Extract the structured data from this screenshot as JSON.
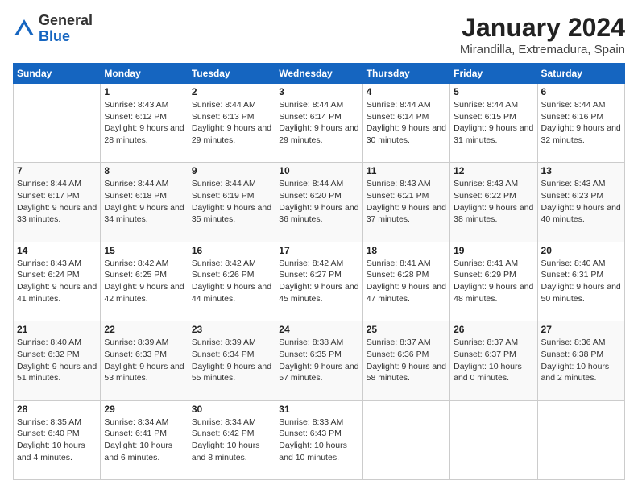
{
  "header": {
    "logo_general": "General",
    "logo_blue": "Blue",
    "month_title": "January 2024",
    "location": "Mirandilla, Extremadura, Spain"
  },
  "days_of_week": [
    "Sunday",
    "Monday",
    "Tuesday",
    "Wednesday",
    "Thursday",
    "Friday",
    "Saturday"
  ],
  "weeks": [
    [
      {
        "day": "",
        "sunrise": "",
        "sunset": "",
        "daylight": ""
      },
      {
        "day": "1",
        "sunrise": "Sunrise: 8:43 AM",
        "sunset": "Sunset: 6:12 PM",
        "daylight": "Daylight: 9 hours and 28 minutes."
      },
      {
        "day": "2",
        "sunrise": "Sunrise: 8:44 AM",
        "sunset": "Sunset: 6:13 PM",
        "daylight": "Daylight: 9 hours and 29 minutes."
      },
      {
        "day": "3",
        "sunrise": "Sunrise: 8:44 AM",
        "sunset": "Sunset: 6:14 PM",
        "daylight": "Daylight: 9 hours and 29 minutes."
      },
      {
        "day": "4",
        "sunrise": "Sunrise: 8:44 AM",
        "sunset": "Sunset: 6:14 PM",
        "daylight": "Daylight: 9 hours and 30 minutes."
      },
      {
        "day": "5",
        "sunrise": "Sunrise: 8:44 AM",
        "sunset": "Sunset: 6:15 PM",
        "daylight": "Daylight: 9 hours and 31 minutes."
      },
      {
        "day": "6",
        "sunrise": "Sunrise: 8:44 AM",
        "sunset": "Sunset: 6:16 PM",
        "daylight": "Daylight: 9 hours and 32 minutes."
      }
    ],
    [
      {
        "day": "7",
        "sunrise": "Sunrise: 8:44 AM",
        "sunset": "Sunset: 6:17 PM",
        "daylight": "Daylight: 9 hours and 33 minutes."
      },
      {
        "day": "8",
        "sunrise": "Sunrise: 8:44 AM",
        "sunset": "Sunset: 6:18 PM",
        "daylight": "Daylight: 9 hours and 34 minutes."
      },
      {
        "day": "9",
        "sunrise": "Sunrise: 8:44 AM",
        "sunset": "Sunset: 6:19 PM",
        "daylight": "Daylight: 9 hours and 35 minutes."
      },
      {
        "day": "10",
        "sunrise": "Sunrise: 8:44 AM",
        "sunset": "Sunset: 6:20 PM",
        "daylight": "Daylight: 9 hours and 36 minutes."
      },
      {
        "day": "11",
        "sunrise": "Sunrise: 8:43 AM",
        "sunset": "Sunset: 6:21 PM",
        "daylight": "Daylight: 9 hours and 37 minutes."
      },
      {
        "day": "12",
        "sunrise": "Sunrise: 8:43 AM",
        "sunset": "Sunset: 6:22 PM",
        "daylight": "Daylight: 9 hours and 38 minutes."
      },
      {
        "day": "13",
        "sunrise": "Sunrise: 8:43 AM",
        "sunset": "Sunset: 6:23 PM",
        "daylight": "Daylight: 9 hours and 40 minutes."
      }
    ],
    [
      {
        "day": "14",
        "sunrise": "Sunrise: 8:43 AM",
        "sunset": "Sunset: 6:24 PM",
        "daylight": "Daylight: 9 hours and 41 minutes."
      },
      {
        "day": "15",
        "sunrise": "Sunrise: 8:42 AM",
        "sunset": "Sunset: 6:25 PM",
        "daylight": "Daylight: 9 hours and 42 minutes."
      },
      {
        "day": "16",
        "sunrise": "Sunrise: 8:42 AM",
        "sunset": "Sunset: 6:26 PM",
        "daylight": "Daylight: 9 hours and 44 minutes."
      },
      {
        "day": "17",
        "sunrise": "Sunrise: 8:42 AM",
        "sunset": "Sunset: 6:27 PM",
        "daylight": "Daylight: 9 hours and 45 minutes."
      },
      {
        "day": "18",
        "sunrise": "Sunrise: 8:41 AM",
        "sunset": "Sunset: 6:28 PM",
        "daylight": "Daylight: 9 hours and 47 minutes."
      },
      {
        "day": "19",
        "sunrise": "Sunrise: 8:41 AM",
        "sunset": "Sunset: 6:29 PM",
        "daylight": "Daylight: 9 hours and 48 minutes."
      },
      {
        "day": "20",
        "sunrise": "Sunrise: 8:40 AM",
        "sunset": "Sunset: 6:31 PM",
        "daylight": "Daylight: 9 hours and 50 minutes."
      }
    ],
    [
      {
        "day": "21",
        "sunrise": "Sunrise: 8:40 AM",
        "sunset": "Sunset: 6:32 PM",
        "daylight": "Daylight: 9 hours and 51 minutes."
      },
      {
        "day": "22",
        "sunrise": "Sunrise: 8:39 AM",
        "sunset": "Sunset: 6:33 PM",
        "daylight": "Daylight: 9 hours and 53 minutes."
      },
      {
        "day": "23",
        "sunrise": "Sunrise: 8:39 AM",
        "sunset": "Sunset: 6:34 PM",
        "daylight": "Daylight: 9 hours and 55 minutes."
      },
      {
        "day": "24",
        "sunrise": "Sunrise: 8:38 AM",
        "sunset": "Sunset: 6:35 PM",
        "daylight": "Daylight: 9 hours and 57 minutes."
      },
      {
        "day": "25",
        "sunrise": "Sunrise: 8:37 AM",
        "sunset": "Sunset: 6:36 PM",
        "daylight": "Daylight: 9 hours and 58 minutes."
      },
      {
        "day": "26",
        "sunrise": "Sunrise: 8:37 AM",
        "sunset": "Sunset: 6:37 PM",
        "daylight": "Daylight: 10 hours and 0 minutes."
      },
      {
        "day": "27",
        "sunrise": "Sunrise: 8:36 AM",
        "sunset": "Sunset: 6:38 PM",
        "daylight": "Daylight: 10 hours and 2 minutes."
      }
    ],
    [
      {
        "day": "28",
        "sunrise": "Sunrise: 8:35 AM",
        "sunset": "Sunset: 6:40 PM",
        "daylight": "Daylight: 10 hours and 4 minutes."
      },
      {
        "day": "29",
        "sunrise": "Sunrise: 8:34 AM",
        "sunset": "Sunset: 6:41 PM",
        "daylight": "Daylight: 10 hours and 6 minutes."
      },
      {
        "day": "30",
        "sunrise": "Sunrise: 8:34 AM",
        "sunset": "Sunset: 6:42 PM",
        "daylight": "Daylight: 10 hours and 8 minutes."
      },
      {
        "day": "31",
        "sunrise": "Sunrise: 8:33 AM",
        "sunset": "Sunset: 6:43 PM",
        "daylight": "Daylight: 10 hours and 10 minutes."
      },
      {
        "day": "",
        "sunrise": "",
        "sunset": "",
        "daylight": ""
      },
      {
        "day": "",
        "sunrise": "",
        "sunset": "",
        "daylight": ""
      },
      {
        "day": "",
        "sunrise": "",
        "sunset": "",
        "daylight": ""
      }
    ]
  ]
}
